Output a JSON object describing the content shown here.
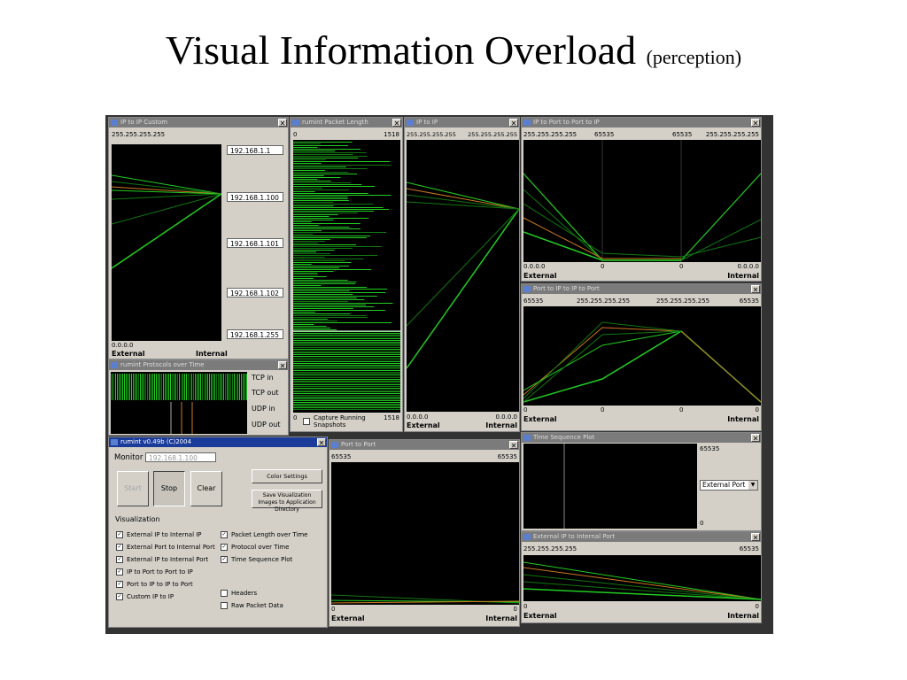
{
  "slide": {
    "title": "Visual Information Overload",
    "subtitle": "(perception)"
  },
  "colors": {
    "plot_bg": "#000000",
    "trace_green": "#22cc22",
    "trace_dark_green": "#117711",
    "trace_orange": "#cc7722",
    "title_active": "#1a3b9a",
    "title_inactive": "#7b7b7b"
  },
  "windows": {
    "custom": {
      "title": "IP to IP Custom",
      "top_label": "255.255.255.255",
      "ips": [
        "192.168.1.1",
        "192.168.1.100",
        "192.168.1.101",
        "192.168.1.102",
        "192.168.1.255"
      ],
      "bottom_label": "0.0.0.0",
      "left_axis": "External",
      "right_axis": "Internal"
    },
    "packet_length": {
      "title": "rumint Packet Length",
      "axis_min": "0",
      "axis_max": "1518",
      "capture_label": "Capture Running Snapshots"
    },
    "ip_to_ip": {
      "title": "IP to IP",
      "left_top": "255.255.255.255",
      "right_top": "255.255.255.255",
      "left_bottom": "0.0.0.0",
      "right_bottom": "0.0.0.0",
      "left_axis": "External",
      "right_axis": "Internal"
    },
    "ip_port_port_ip": {
      "title": "IP to Port to Port to IP",
      "top_labels": [
        "255.255.255.255",
        "65535",
        "65535",
        "255.255.255.255"
      ],
      "bottom_labels": [
        "0.0.0.0",
        "0",
        "0",
        "0.0.0.0"
      ],
      "left_axis": "External",
      "right_axis": "Internal"
    },
    "port_ip_ip_port": {
      "title": "Port to IP to IP to Port",
      "top_labels": [
        "65535",
        "255.255.255.255",
        "255.255.255.255",
        "65535"
      ],
      "bottom_labels": [
        "0",
        "0",
        "0",
        "0"
      ],
      "left_axis": "External",
      "right_axis": "Internal"
    },
    "protocols": {
      "title": "rumint  Protocols over Time",
      "legend": [
        "TCP in",
        "TCP out",
        "UDP in",
        "UDP out"
      ]
    },
    "control": {
      "title": "rumint v0.49b (C)2004",
      "monitor_label": "Monitor",
      "monitor_value": "192.168.1.100",
      "start_label": "Start",
      "stop_label": "Stop",
      "clear_label": "Clear",
      "color_settings_label": "Color Settings",
      "save_images_label": "Save Visualization Images to Application Directory",
      "visualization_label": "Visualization",
      "options_left": [
        {
          "label": "External IP to Internal IP",
          "checked": true
        },
        {
          "label": "External Port to Internal Port",
          "checked": true
        },
        {
          "label": "External IP to Internal Port",
          "checked": true
        },
        {
          "label": "IP to Port to Port to IP",
          "checked": true
        },
        {
          "label": "Port to IP to IP to Port",
          "checked": true
        },
        {
          "label": "Custom IP to IP",
          "checked": true
        }
      ],
      "options_right": [
        {
          "label": "Packet Length over Time",
          "checked": true
        },
        {
          "label": "Protocol over Time",
          "checked": true
        },
        {
          "label": "Time Sequence Plot",
          "checked": true
        },
        {
          "label": "Headers",
          "checked": false
        },
        {
          "label": "Raw Packet Data",
          "checked": false
        }
      ]
    },
    "port_to_port": {
      "title": "Port to Port",
      "left_top": "65535",
      "right_top": "65535",
      "left_bottom": "0",
      "right_bottom": "0",
      "left_axis": "External",
      "right_axis": "Internal"
    },
    "time_sequence": {
      "title": "Time Sequence Plot",
      "top_value": "65535",
      "bottom_value": "0",
      "select_value": "External Port"
    },
    "ext_ip_int_port": {
      "title": "External IP to Internal Port",
      "left_top": "255.255.255.255",
      "right_top": "65535",
      "left_bottom": "0",
      "right_bottom": "0",
      "left_axis": "External",
      "right_axis": "Internal"
    }
  }
}
